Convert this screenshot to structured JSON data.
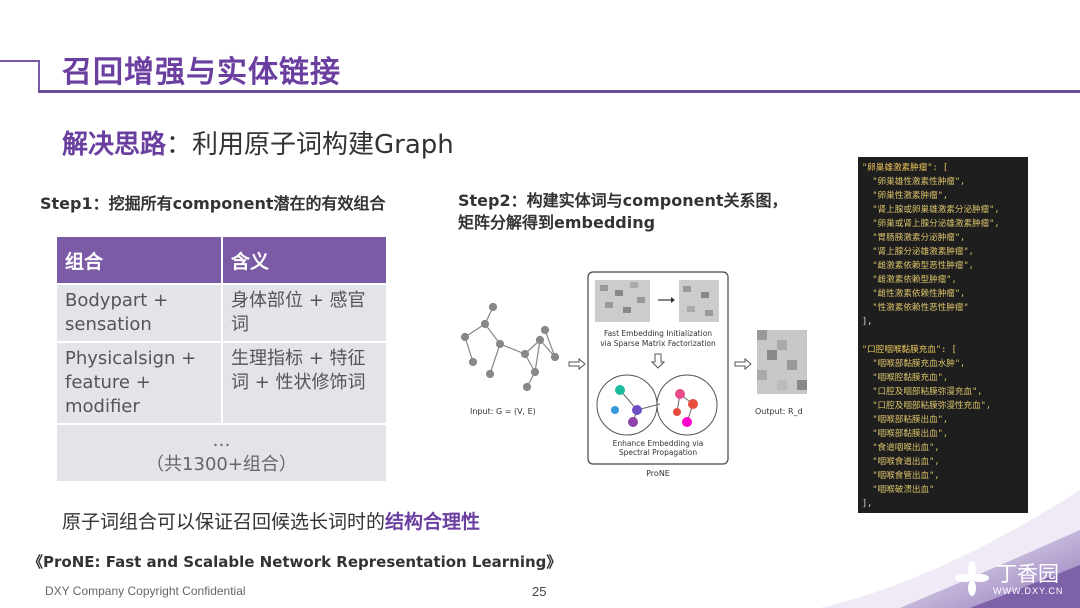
{
  "header": {
    "title": "召回增强与实体链接"
  },
  "subtitle": {
    "highlight": "解决思路",
    "rest": "：利用原子词构建Graph"
  },
  "steps": {
    "step1": "Step1：挖掘所有component潜在的有效组合",
    "step2_line1": "Step2：构建实体词与component关系图，",
    "step2_line2": "矩阵分解得到embedding"
  },
  "table": {
    "headers": [
      "组合",
      "含义"
    ],
    "rows": [
      {
        "combo": "Bodypart + sensation",
        "meaning": "身体部位 + 感官词"
      },
      {
        "combo": "Physicalsign + feature + modifier",
        "meaning": "生理指标 + 特征词 + 性状修饰词"
      }
    ],
    "footer_line1": "…",
    "footer_line2": "（共1300+组合）"
  },
  "diagram": {
    "input_label": "Input: G = (V, E)",
    "box_title": "Fast Embedding Initialization via Sparse Matrix Factorization",
    "box_title_l1": "Fast Embedding Initialization",
    "box_title_l2": "via Sparse Matrix Factorization",
    "enhance_l1": "Enhance Embedding via",
    "enhance_l2": "Spectral Propagation",
    "name": "ProNE",
    "output_label": "Output: R_d"
  },
  "code_block": {
    "group1_key": "\"卵巢雄激素肿瘤\": [",
    "group1": [
      "\"卵巢雄性激素性肿瘤\",",
      "\"卵巢性激素肿瘤\",",
      "\"肾上腺或卵巢雄激素分泌肿瘤\",",
      "\"卵巢或肾上腺分泌雄激素肿瘤\",",
      "\"胃肠胰激素分泌肿瘤\",",
      "\"肾上腺分泌雄激素肿瘤\",",
      "\"雌激素依赖型恶性肿瘤\",",
      "\"雌激素依赖型肿瘤\",",
      "\"雌性激素依赖性肿瘤\",",
      "\"性激素依赖性恶性肿瘤\""
    ],
    "group1_end": "],",
    "group2_key": "\"口腔咽喉黏膜充血\": [",
    "group2": [
      "\"咽喉部黏膜充血水肿\",",
      "\"咽喉腔黏膜充血\",",
      "\"口腔及咽部粘膜弥漫充血\",",
      "\"口腔及咽部粘膜弥漫性充血\",",
      "\"咽喉部粘膜出血\",",
      "\"咽喉部黏膜出血\",",
      "\"食道咽喉出血\",",
      "\"咽喉食道出血\",",
      "\"咽喉食管出血\",",
      "\"咽喉破溃出血\""
    ],
    "group2_end": "],"
  },
  "conclusion": {
    "text": "原子词组合可以保证召回候选长词时的",
    "highlight": "结构合理性"
  },
  "reference": "《ProNE: Fast and Scalable Network Representation Learning》",
  "footer": {
    "copyright": "DXY Company Copyright Confidential",
    "page": "25"
  },
  "logo": {
    "name": "丁香园",
    "url": "WWW.DXY.CN"
  },
  "colors": {
    "accent": "#6a3fa0",
    "table_header": "#7b5aa6",
    "table_cell": "#e3e3ea",
    "code_bg": "#1e1e1e",
    "code_text": "#d9c16a"
  }
}
